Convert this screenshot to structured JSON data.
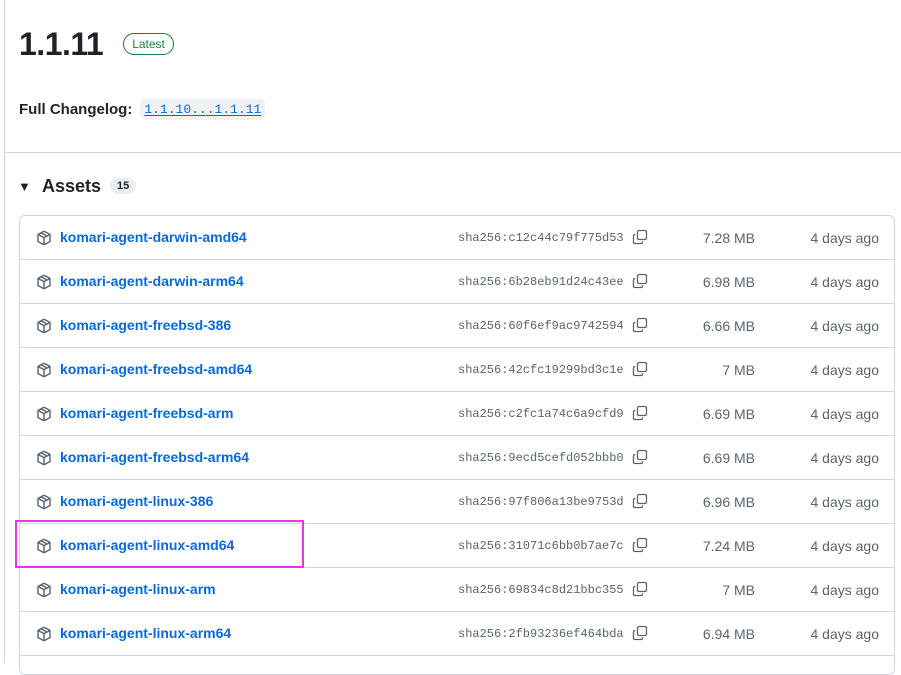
{
  "release": {
    "title": "1.1.11",
    "badge": "Latest",
    "changelog_label": "Full Changelog:",
    "changelog_link": "1.1.10...1.1.11"
  },
  "assets": {
    "title": "Assets",
    "count": "15",
    "toggle_icon": "triangle-down-icon",
    "rows": [
      {
        "name": "komari-agent-darwin-amd64",
        "hash": "sha256:c12c44c79f775d534…",
        "size": "7.28 MB",
        "date": "4 days ago"
      },
      {
        "name": "komari-agent-darwin-arm64",
        "hash": "sha256:6b28eb91d24c43ee7…",
        "size": "6.98 MB",
        "date": "4 days ago"
      },
      {
        "name": "komari-agent-freebsd-386",
        "hash": "sha256:60f6ef9ac97425946…",
        "size": "6.66 MB",
        "date": "4 days ago"
      },
      {
        "name": "komari-agent-freebsd-amd64",
        "hash": "sha256:42cfc19299bd3c1ef…",
        "size": "7 MB",
        "date": "4 days ago"
      },
      {
        "name": "komari-agent-freebsd-arm",
        "hash": "sha256:c2fc1a74c6a9cfd9c…",
        "size": "6.69 MB",
        "date": "4 days ago"
      },
      {
        "name": "komari-agent-freebsd-arm64",
        "hash": "sha256:9ecd5cefd052bbb04…",
        "size": "6.69 MB",
        "date": "4 days ago"
      },
      {
        "name": "komari-agent-linux-386",
        "hash": "sha256:97f806a13be9753d5…",
        "size": "6.96 MB",
        "date": "4 days ago"
      },
      {
        "name": "komari-agent-linux-amd64",
        "hash": "sha256:31071c6bb0b7ae7cd…",
        "size": "7.24 MB",
        "date": "4 days ago"
      },
      {
        "name": "komari-agent-linux-arm",
        "hash": "sha256:69834c8d21bbc3555…",
        "size": "7 MB",
        "date": "4 days ago"
      },
      {
        "name": "komari-agent-linux-arm64",
        "hash": "sha256:2fb93236ef464bda4…",
        "size": "6.94 MB",
        "date": "4 days ago"
      }
    ]
  },
  "icons": {
    "package": "package-icon",
    "copy": "copy-icon"
  },
  "colors": {
    "link": "#0969da",
    "badge_green": "#1a7f37",
    "highlight": "#e836e0",
    "muted": "#59636e"
  }
}
